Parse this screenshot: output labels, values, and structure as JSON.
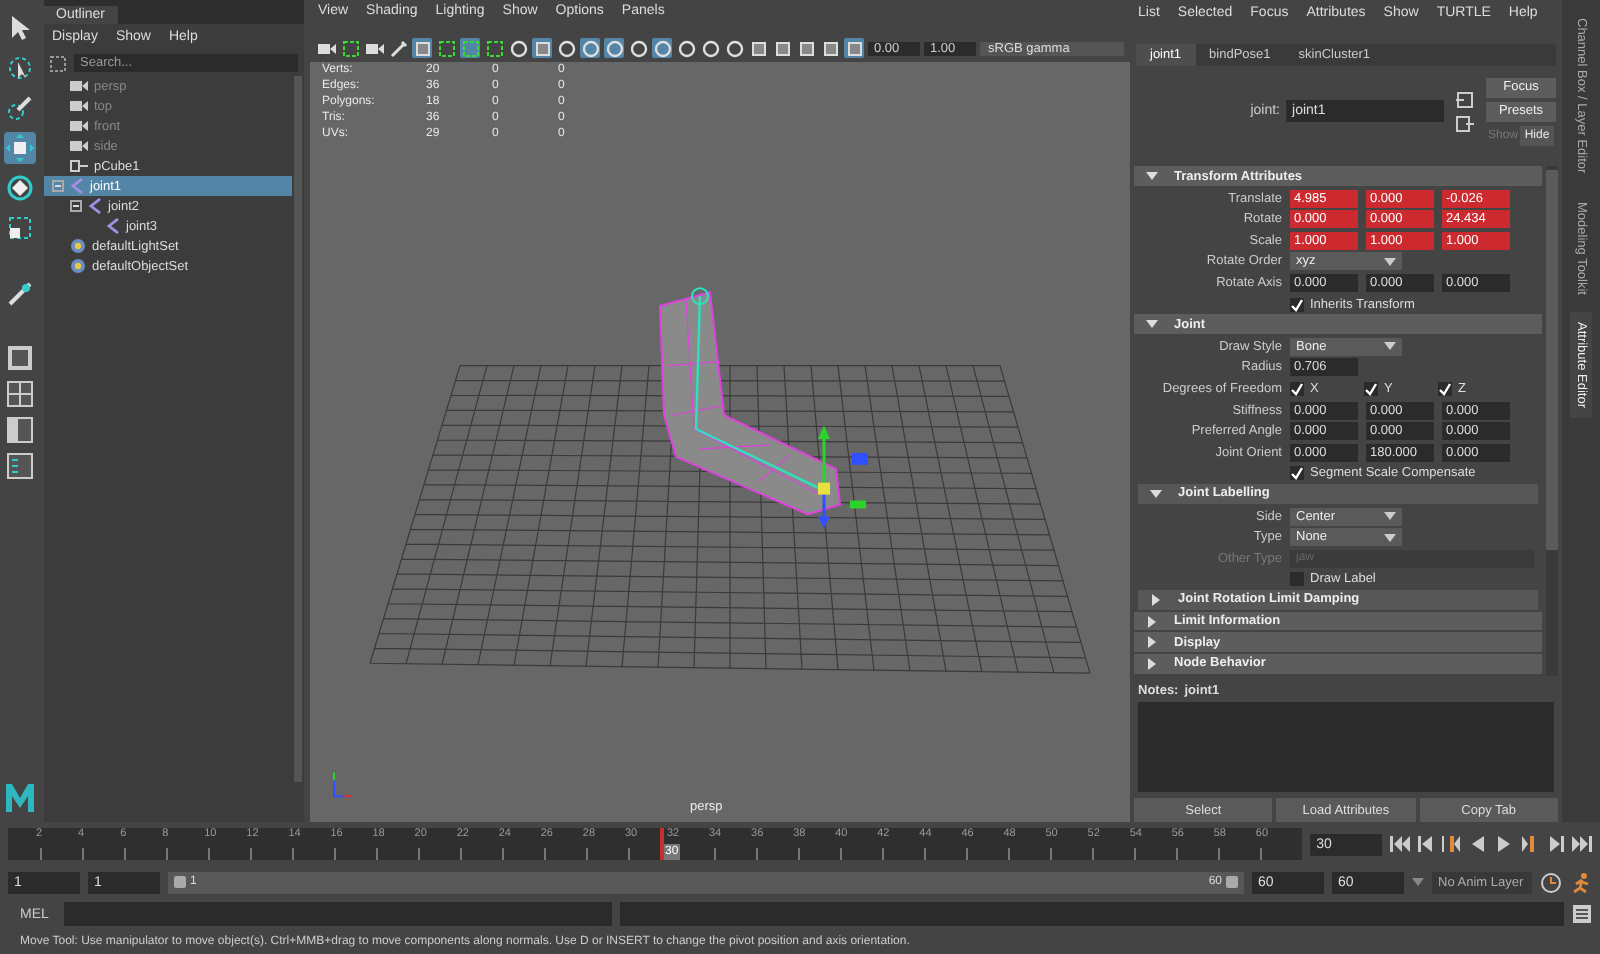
{
  "tools": [
    {
      "kind": "select",
      "selected": false
    },
    {
      "kind": "lasso",
      "selected": false
    },
    {
      "kind": "paint",
      "selected": false
    },
    {
      "kind": "move",
      "selected": true
    },
    {
      "kind": "rotate",
      "selected": false
    },
    {
      "kind": "scale",
      "selected": false
    }
  ],
  "outliner": {
    "title": "Outliner",
    "menu": [
      "Display",
      "Show",
      "Help"
    ],
    "search": {
      "placeholder": "Search..."
    },
    "items": [
      {
        "name": "persp",
        "kind": "camera",
        "dimmed": true,
        "selected": false
      },
      {
        "name": "top",
        "kind": "camera",
        "dimmed": true,
        "selected": false
      },
      {
        "name": "front",
        "kind": "camera",
        "dimmed": true,
        "selected": false
      },
      {
        "name": "side",
        "kind": "camera",
        "dimmed": true,
        "selected": false
      },
      {
        "name": "pCube1",
        "kind": "mesh",
        "dimmed": false,
        "selected": false
      },
      {
        "name": "joint1",
        "kind": "joint",
        "dimmed": false,
        "selected": true,
        "expanded": true,
        "children": [
          {
            "name": "joint2",
            "kind": "joint",
            "dimmed": false,
            "selected": false,
            "expanded": true,
            "children": [
              {
                "name": "joint3",
                "kind": "joint",
                "dimmed": false,
                "selected": false
              }
            ]
          }
        ]
      },
      {
        "name": "defaultLightSet",
        "kind": "set",
        "dimmed": false,
        "selected": false
      },
      {
        "name": "defaultObjectSet",
        "kind": "set",
        "dimmed": false,
        "selected": false
      }
    ]
  },
  "viewport": {
    "menu": [
      "View",
      "Shading",
      "Lighting",
      "Show",
      "Options",
      "Panels"
    ],
    "toolbar": [
      {
        "kind": "camera",
        "on": false
      },
      {
        "kind": "frame",
        "on": false
      },
      {
        "kind": "camera",
        "on": false
      },
      {
        "kind": "paint",
        "on": false
      },
      {
        "kind": "square",
        "on": true
      },
      {
        "kind": "frame",
        "on": false
      },
      {
        "kind": "frame",
        "on": true
      },
      {
        "kind": "frame",
        "on": false
      },
      {
        "kind": "round",
        "on": false
      },
      {
        "kind": "square",
        "on": true
      },
      {
        "kind": "round",
        "on": false
      },
      {
        "kind": "round",
        "on": true
      },
      {
        "kind": "round",
        "on": true
      },
      {
        "kind": "round",
        "on": false
      },
      {
        "kind": "round",
        "on": true
      },
      {
        "kind": "round",
        "on": false
      },
      {
        "kind": "round",
        "on": false
      },
      {
        "kind": "round",
        "on": false
      },
      {
        "kind": "square",
        "on": false
      },
      {
        "kind": "square",
        "on": false
      },
      {
        "kind": "square",
        "on": false
      },
      {
        "kind": "square",
        "on": false
      },
      {
        "kind": "square",
        "on": true
      }
    ],
    "exposure": "0.00",
    "gamma": "1.00",
    "colorspace": "sRGB gamma",
    "stats": [
      {
        "label": "Verts:",
        "values": [
          "20",
          "0",
          "0"
        ]
      },
      {
        "label": "Edges:",
        "values": [
          "36",
          "0",
          "0"
        ]
      },
      {
        "label": "Polygons:",
        "values": [
          "18",
          "0",
          "0"
        ]
      },
      {
        "label": "Tris:",
        "values": [
          "36",
          "0",
          "0"
        ]
      },
      {
        "label": "UVs:",
        "values": [
          "29",
          "0",
          "0"
        ]
      }
    ],
    "camera": "persp"
  },
  "attribute_editor": {
    "menu": [
      "List",
      "Selected",
      "Focus",
      "Attributes",
      "Show",
      "TURTLE",
      "Help"
    ],
    "tabs": [
      {
        "label": "joint1",
        "selected": true
      },
      {
        "label": "bindPose1",
        "selected": false
      },
      {
        "label": "skinCluster1",
        "selected": false
      }
    ],
    "node_label": "joint:",
    "node_name": "joint1",
    "focus": "Focus",
    "presets": "Presets",
    "show_hide": [
      {
        "label": "Show",
        "selected": false
      },
      {
        "label": "Hide",
        "selected": true
      }
    ],
    "sections": [
      {
        "title": "Transform Attributes",
        "expanded": true,
        "rows": [
          {
            "kind": "vector",
            "label": "Translate",
            "values": [
              "4.985",
              "0.000",
              "-0.026"
            ],
            "keyed": true
          },
          {
            "kind": "vector",
            "label": "Rotate",
            "values": [
              "0.000",
              "0.000",
              "24.434"
            ],
            "keyed": true
          },
          {
            "kind": "vector",
            "label": "Scale",
            "values": [
              "1.000",
              "1.000",
              "1.000"
            ],
            "keyed": true
          },
          {
            "kind": "dropdown",
            "label": "Rotate Order",
            "value": "xyz"
          },
          {
            "kind": "vector",
            "label": "Rotate Axis",
            "values": [
              "0.000",
              "0.000",
              "0.000"
            ],
            "keyed": false
          },
          {
            "kind": "checkbox",
            "label": "Inherits Transform",
            "checked": true
          }
        ]
      },
      {
        "title": "Joint",
        "expanded": true,
        "rows": [
          {
            "kind": "dropdown",
            "label": "Draw Style",
            "value": "Bone"
          },
          {
            "kind": "field",
            "label": "Radius",
            "value": "0.706"
          },
          {
            "kind": "axes",
            "label": "Degrees of Freedom",
            "options": [
              {
                "label": "X",
                "checked": true
              },
              {
                "label": "Y",
                "checked": true
              },
              {
                "label": "Z",
                "checked": true
              }
            ]
          },
          {
            "kind": "vector",
            "label": "Stiffness",
            "values": [
              "0.000",
              "0.000",
              "0.000"
            ],
            "keyed": false
          },
          {
            "kind": "vector",
            "label": "Preferred Angle",
            "values": [
              "0.000",
              "0.000",
              "0.000"
            ],
            "keyed": false
          },
          {
            "kind": "vector",
            "label": "Joint Orient",
            "values": [
              "0.000",
              "180.000",
              "0.000"
            ],
            "keyed": false
          },
          {
            "kind": "checkbox",
            "label": "Segment Scale Compensate",
            "checked": true
          }
        ],
        "children": [
          {
            "title": "Joint Labelling",
            "expanded": true,
            "rows": [
              {
                "kind": "dropdown",
                "label": "Side",
                "value": "Center"
              },
              {
                "kind": "dropdown",
                "label": "Type",
                "value": "None"
              },
              {
                "kind": "text",
                "label": "Other Type",
                "placeholder": "jaw",
                "disabled": true
              },
              {
                "kind": "checkbox",
                "label": "Draw Label",
                "checked": false
              }
            ]
          },
          {
            "title": "Joint Rotation Limit Damping",
            "expanded": false
          }
        ]
      },
      {
        "title": "Limit Information",
        "expanded": false
      },
      {
        "title": "Display",
        "expanded": false
      },
      {
        "title": "Node Behavior",
        "expanded": false
      }
    ],
    "notes_label": "Notes:",
    "notes_node": "joint1",
    "buttons": [
      "Select",
      "Load Attributes",
      "Copy Tab"
    ]
  },
  "side_tabs": [
    {
      "label": "Channel Box / Layer Editor",
      "selected": false
    },
    {
      "label": "Modeling Toolkit",
      "selected": false
    },
    {
      "label": "Attribute Editor",
      "selected": true
    }
  ],
  "timeline": {
    "ticks": [
      "2",
      "4",
      "6",
      "8",
      "10",
      "12",
      "14",
      "16",
      "18",
      "20",
      "22",
      "24",
      "26",
      "28",
      "30",
      "32",
      "34",
      "36",
      "38",
      "40",
      "42",
      "44",
      "46",
      "48",
      "50",
      "52",
      "54",
      "56",
      "58",
      "60"
    ],
    "playhead": {
      "label": "30",
      "level": 0.492
    },
    "current_frame": "30"
  },
  "range": {
    "start": "1",
    "playback_start": "1",
    "slider_start": "1",
    "slider_end": "60",
    "level": 1,
    "playback_end": "60",
    "end": "60",
    "anim_layer": "No Anim Layer"
  },
  "command": {
    "label": "MEL"
  },
  "status": "Move Tool: Use manipulator to move object(s). Ctrl+MMB+drag to move components along normals. Use D or INSERT to change the pivot position and axis orientation."
}
